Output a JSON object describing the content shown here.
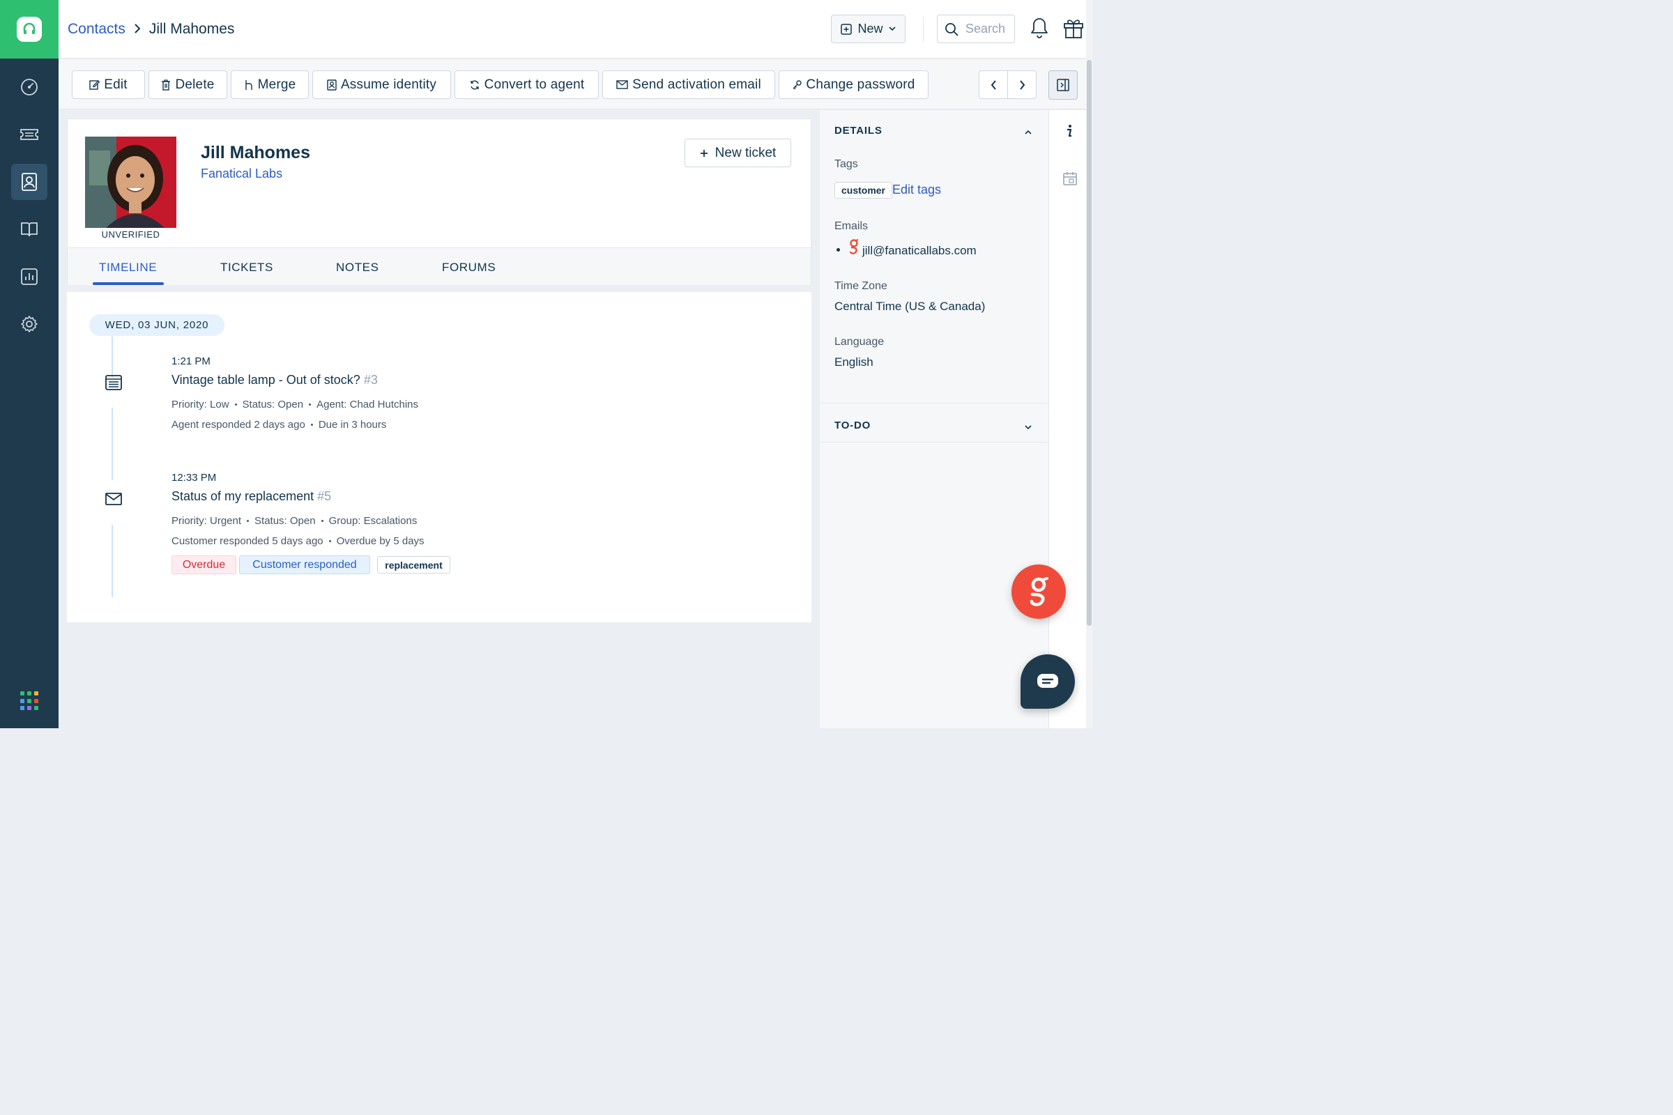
{
  "header": {
    "breadcrumb_parent": "Contacts",
    "breadcrumb_current": "Jill Mahomes",
    "new_label": "New",
    "search_placeholder": "Search"
  },
  "toolbar": {
    "edit": "Edit",
    "delete": "Delete",
    "merge": "Merge",
    "assume_identity": "Assume identity",
    "convert_to_agent": "Convert to agent",
    "send_activation_email": "Send activation email",
    "change_password": "Change password"
  },
  "profile": {
    "name": "Jill Mahomes",
    "company": "Fanatical Labs",
    "verification_status": "UNVERIFIED",
    "new_ticket_label": "New ticket"
  },
  "tabs": [
    "TIMELINE",
    "TICKETS",
    "NOTES",
    "FORUMS"
  ],
  "timeline": {
    "date": "WED, 03 JUN, 2020",
    "events": [
      {
        "time": "1:21 PM",
        "icon": "ticket-portal-icon",
        "title": "Vintage table lamp - Out of stock?",
        "number": "#3",
        "meta1": [
          "Priority: Low",
          "Status: Open",
          "Agent: Chad Hutchins"
        ],
        "meta2": [
          "Agent responded 2 days ago",
          "Due in 3 hours"
        ]
      },
      {
        "time": "12:33 PM",
        "icon": "email-icon",
        "title": "Status of my replacement",
        "number": "#5",
        "meta1": [
          "Priority: Urgent",
          "Status: Open",
          "Group: Escalations"
        ],
        "meta2": [
          "Customer responded 5 days ago",
          "Overdue by 5 days"
        ],
        "chips": [
          "Overdue",
          "Customer responded",
          "replacement"
        ]
      }
    ]
  },
  "details": {
    "heading": "DETAILS",
    "tags_label": "Tags",
    "tag": "customer",
    "edit_tags": "Edit tags",
    "emails_label": "Emails",
    "email": "jill@fanaticallabs.com",
    "timezone_label": "Time Zone",
    "timezone": "Central Time (US & Canada)",
    "language_label": "Language",
    "language": "English",
    "todo_heading": "TO-DO"
  },
  "colors": {
    "brand_green": "#2fbf71",
    "nav_bg": "#1f3a4d",
    "link_blue": "#2c5cc5",
    "freddy_red": "#f04b3a"
  }
}
